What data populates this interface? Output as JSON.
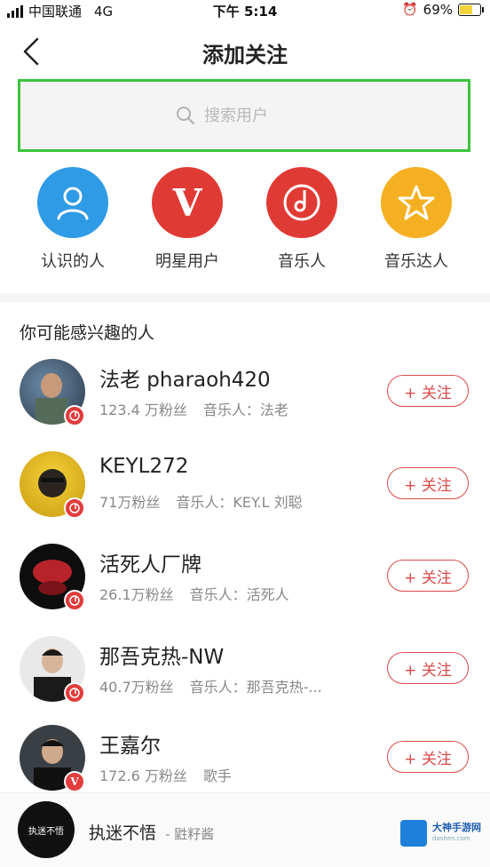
{
  "status_bar": {
    "carrier": "中国联通",
    "network": "4G",
    "time": "下午 5:14",
    "battery": "69%",
    "battery_level": 0.69
  },
  "navbar": {
    "title": "添加关注"
  },
  "search": {
    "placeholder": "搜索用户"
  },
  "categories": [
    {
      "label": "认识的人",
      "color": "#2f9be6",
      "icon": "person-icon"
    },
    {
      "label": "明星用户",
      "color": "#e03a34",
      "icon": "v-icon"
    },
    {
      "label": "音乐人",
      "color": "#e03a34",
      "icon": "note-circle-icon"
    },
    {
      "label": "音乐达人",
      "color": "#f5b021",
      "icon": "star-icon"
    }
  ],
  "section_title": "你可能感兴趣的人",
  "users": [
    {
      "name": "法老 pharaoh420",
      "fans": "123.4 万粉丝",
      "tag": "音乐人：法老",
      "follow": "+ 关注"
    },
    {
      "name": "KEYL272",
      "fans": "71万粉丝",
      "tag": "音乐人：KEY.L 刘聪",
      "follow": "+ 关注"
    },
    {
      "name": "活死人厂牌",
      "fans": "26.1万粉丝",
      "tag": "音乐人：活死人",
      "follow": "+ 关注"
    },
    {
      "name": "那吾克热-NW",
      "fans": "40.7万粉丝",
      "tag": "音乐人：那吾克热-...",
      "follow": "+ 关注"
    },
    {
      "name": "王嘉尔",
      "fans": "172.6 万粉丝",
      "tag": "歌手",
      "follow": "+ 关注"
    }
  ],
  "player": {
    "song": "执迷不悟",
    "artist": "- 鼪籽酱",
    "cover_text": "执迷不悟"
  },
  "watermark": {
    "name": "大神手游网",
    "url": "dashen.com"
  },
  "colors": {
    "accent": "#d84a4a",
    "search_highlight": "#3cc43c"
  }
}
